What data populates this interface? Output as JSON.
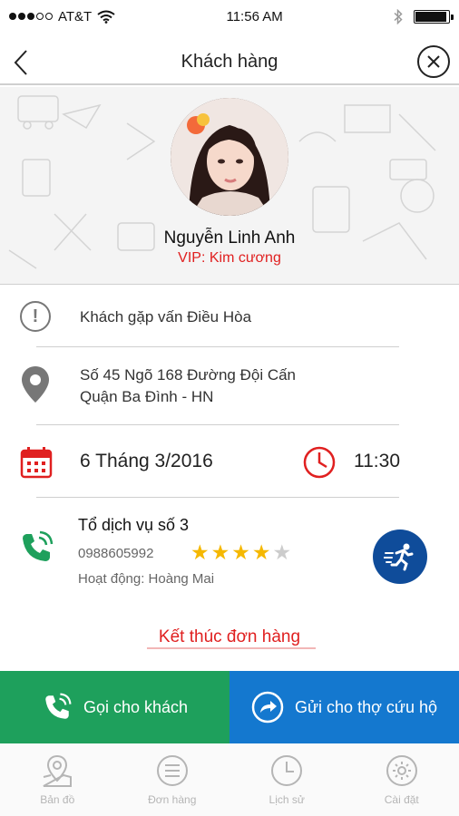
{
  "status_bar": {
    "carrier": "AT&T",
    "time": "11:56 AM",
    "signal_icon": "signal-dots-icon",
    "wifi_icon": "wifi-icon",
    "bluetooth_icon": "bluetooth-icon",
    "battery_icon": "battery-icon",
    "battery_level": 0.95
  },
  "header": {
    "title": "Khách hàng",
    "back_icon": "chevron-left-icon",
    "close_icon": "close-circle-icon"
  },
  "profile": {
    "name": "Nguyễn Linh Anh",
    "vip": "VIP: Kim cương"
  },
  "issue": {
    "text": "Khách gặp vấn Điều Hòa",
    "icon": "alert-circle-icon"
  },
  "address": {
    "line1": "Số 45 Ngõ 168 Đường Đội Cấn",
    "line2": "Quận Ba Đình - HN",
    "icon": "map-pin-icon"
  },
  "schedule": {
    "date": "6 Tháng 3/2016",
    "time": "11:30",
    "date_icon": "calendar-icon",
    "time_icon": "clock-icon"
  },
  "service": {
    "name": "Tổ dịch vụ số 3",
    "phone": "0988605992",
    "area": "Hoạt động: Hoàng Mai",
    "rating": 4,
    "rating_max": 5,
    "phone_icon": "phone-call-icon",
    "action_icon": "running-man-icon"
  },
  "finish_link": "Kết thúc đơn hàng",
  "actions": {
    "call_label": "Gọi cho khách",
    "send_label": "Gửi cho thợ cứu hộ"
  },
  "tabs": [
    {
      "label": "Bản đồ",
      "icon": "map-icon"
    },
    {
      "label": "Đơn hàng",
      "icon": "list-icon"
    },
    {
      "label": "Lịch sử",
      "icon": "clock-icon"
    },
    {
      "label": "Cài đặt",
      "icon": "gear-icon"
    }
  ],
  "colors": {
    "accent_red": "#e02020",
    "call_green": "#1ea05c",
    "send_blue": "#1478cf",
    "run_navy": "#0f4c9a",
    "star_gold": "#f5b800",
    "star_empty": "#cccccc"
  }
}
